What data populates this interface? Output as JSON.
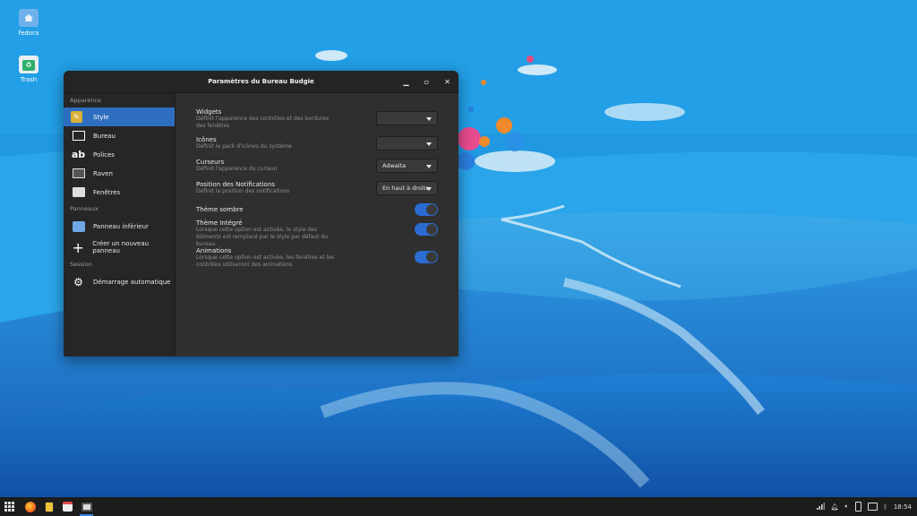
{
  "desktop": {
    "icons": [
      {
        "label": "fedora",
        "icon": "folder-home-icon"
      },
      {
        "label": "Trash",
        "icon": "trash-icon"
      }
    ]
  },
  "window": {
    "title": "Paramètres du Bureau Budgie",
    "controls": [
      "minimize",
      "maximize",
      "close"
    ]
  },
  "sidebar": {
    "sections": [
      {
        "heading": "Apparence",
        "items": [
          {
            "label": "Style",
            "icon": "style-icon",
            "active": true
          },
          {
            "label": "Bureau",
            "icon": "desktop-icon"
          },
          {
            "label": "Polices",
            "icon": "fonts-icon"
          },
          {
            "label": "Raven",
            "icon": "raven-icon"
          },
          {
            "label": "Fenêtres",
            "icon": "windows-icon"
          }
        ]
      },
      {
        "heading": "Panneaux",
        "items": [
          {
            "label": "Panneau inférieur",
            "icon": "panel-icon"
          },
          {
            "label": "Créer un nouveau panneau",
            "icon": "plus-icon"
          }
        ]
      },
      {
        "heading": "Session",
        "items": [
          {
            "label": "Démarrage automatique",
            "icon": "autostart-icon"
          }
        ]
      }
    ]
  },
  "settings": {
    "widgets": {
      "label": "Widgets",
      "desc": "Définit l'apparence des contrôles et des bordures des fenêtres",
      "value": ""
    },
    "icons": {
      "label": "Icônes",
      "desc": "Définit le pack d'icônes du système",
      "value": ""
    },
    "cursors": {
      "label": "Curseurs",
      "desc": "Définit l'apparence du curseur",
      "value": "Adwaita"
    },
    "notif": {
      "label": "Position des Notifications",
      "desc": "Définit la position des notifications",
      "value": "En haut à droite"
    },
    "dark": {
      "label": "Thème sombre",
      "on": true
    },
    "builtin": {
      "label": "Thème Intégré",
      "desc": "Lorsque cette option est activée, le style des éléments est remplacé par le style par défaut du bureau",
      "on": true
    },
    "anim": {
      "label": "Animations",
      "desc": "Lorsque cette option est activée, les fenêtres et les contrôles utiliseront des animations",
      "on": true
    }
  },
  "taskbar": {
    "clock": "18:54",
    "accent": "#3583e3"
  }
}
